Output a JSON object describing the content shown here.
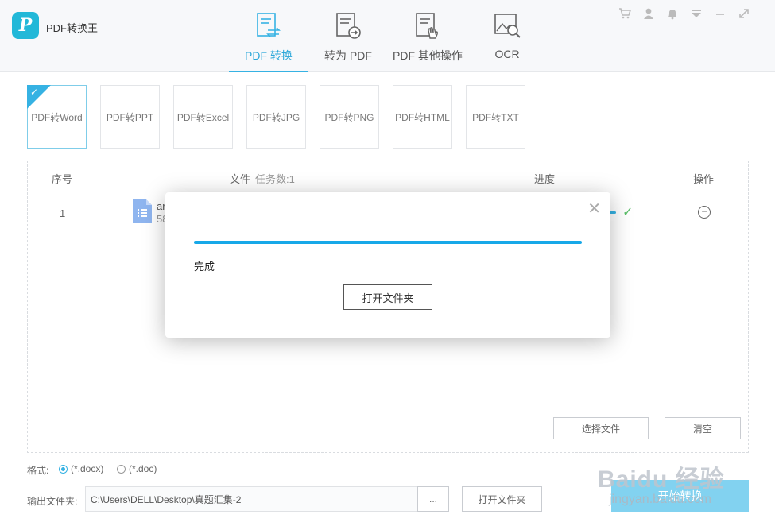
{
  "app": {
    "title": "PDF转换王"
  },
  "tabs": [
    {
      "label": "PDF 转换",
      "icon": "pdf-convert-icon",
      "active": true
    },
    {
      "label": "转为 PDF",
      "icon": "to-pdf-icon",
      "active": false
    },
    {
      "label": "PDF 其他操作",
      "icon": "pdf-other-ops-icon",
      "active": false
    },
    {
      "label": "OCR",
      "icon": "ocr-icon",
      "active": false
    }
  ],
  "top_icons": [
    "cart-icon",
    "user-icon",
    "bell-icon",
    "download-icon",
    "minimize-icon",
    "maximize-icon"
  ],
  "formats": [
    {
      "label": "PDF转Word",
      "selected": true
    },
    {
      "label": "PDF转PPT",
      "selected": false
    },
    {
      "label": "PDF转Excel",
      "selected": false
    },
    {
      "label": "PDF转JPG",
      "selected": false
    },
    {
      "label": "PDF转PNG",
      "selected": false
    },
    {
      "label": "PDF转HTML",
      "selected": false
    },
    {
      "label": "PDF转TXT",
      "selected": false
    }
  ],
  "table": {
    "headers": {
      "index": "序号",
      "file": "文件",
      "task_count": "任务数:1",
      "progress": "进度",
      "action": "操作"
    },
    "rows": [
      {
        "index": "1",
        "name": "ar",
        "size": "58"
      }
    ]
  },
  "buttons": {
    "select_files": "选择文件",
    "clear": "清空",
    "browse": "...",
    "open_folder": "打开文件夹",
    "start": "开始转换"
  },
  "bottom": {
    "format_label": "格式:",
    "format_options": [
      {
        "label": "(*.docx)",
        "checked": true
      },
      {
        "label": "(*.doc)",
        "checked": false
      }
    ],
    "output_label": "输出文件夹:",
    "output_path": "C:\\Users\\DELL\\Desktop\\真题汇集-2"
  },
  "modal": {
    "status": "完成",
    "progress": 1.0,
    "open_folder": "打开文件夹"
  },
  "watermark": {
    "main": "Baidu 经验",
    "sub": "jingyan.baidu.com"
  },
  "colors": {
    "accent": "#36b2e3",
    "progress": "#17a8e8",
    "start_button": "#82d2f0",
    "check": "#5cbf6a"
  }
}
